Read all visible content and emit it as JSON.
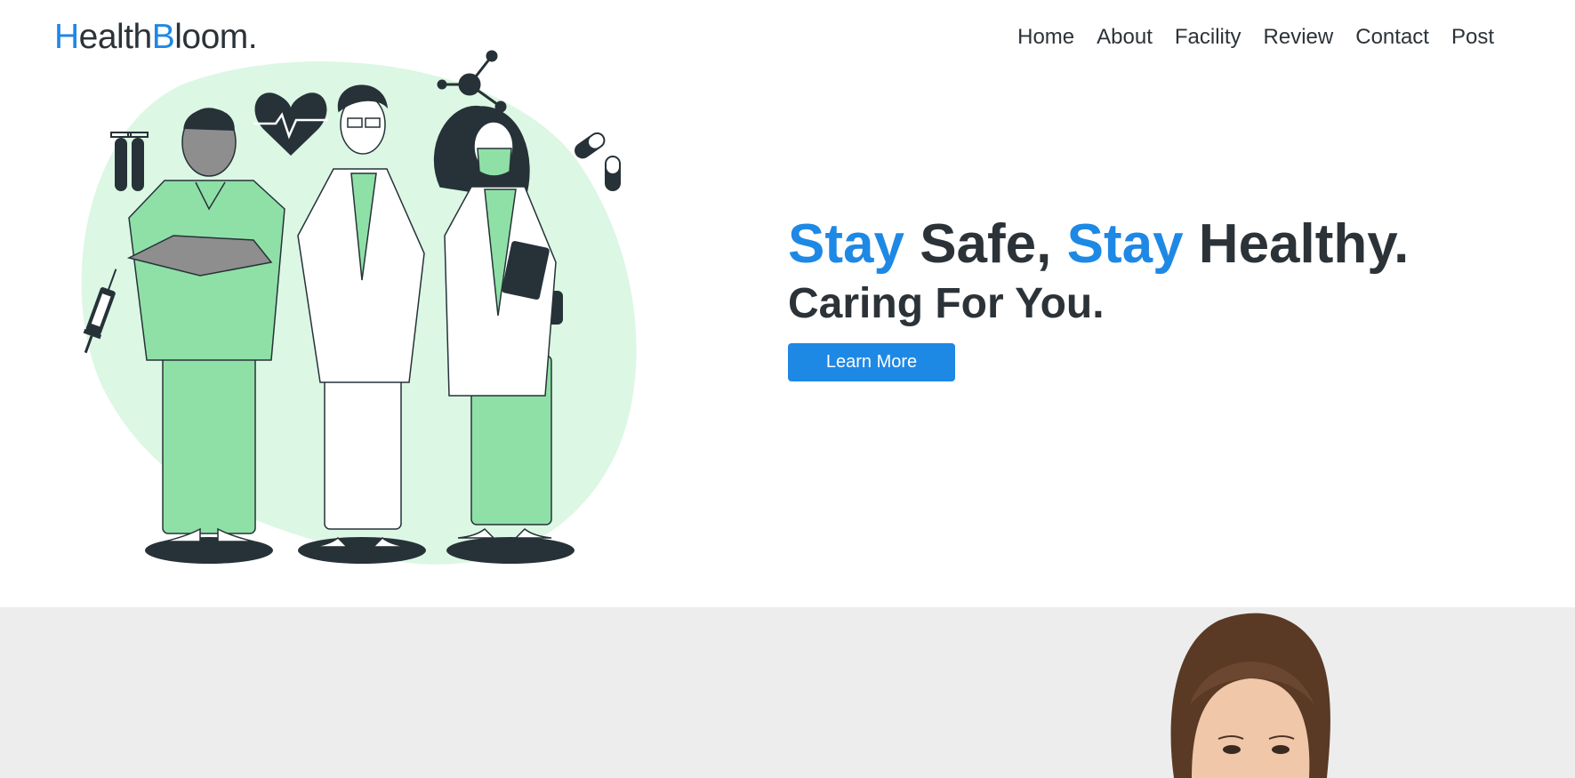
{
  "brand": {
    "first_initial": "H",
    "first_rest": "ealth",
    "second_initial": "B",
    "second_rest": "loom."
  },
  "nav": {
    "home": "Home",
    "about": "About",
    "facility": "Facility",
    "review": "Review",
    "contact": "Contact",
    "post": "Post"
  },
  "hero": {
    "stay1": "Stay",
    "safe": " Safe, ",
    "stay2": "Stay",
    "healthy": " Healthy.",
    "subtitle": "Caring For You.",
    "cta": "Learn More"
  },
  "colors": {
    "accent": "#1e88e5",
    "text": "#2c3338",
    "blob": "#dcf7e4",
    "scrubs": "#8fe0a6",
    "section_bg": "#ededed"
  },
  "icons": [
    "heart-pulse-icon",
    "molecule-icon",
    "test-tubes-icon",
    "pills-icon",
    "syringe-icon",
    "medical-kit-icon"
  ]
}
